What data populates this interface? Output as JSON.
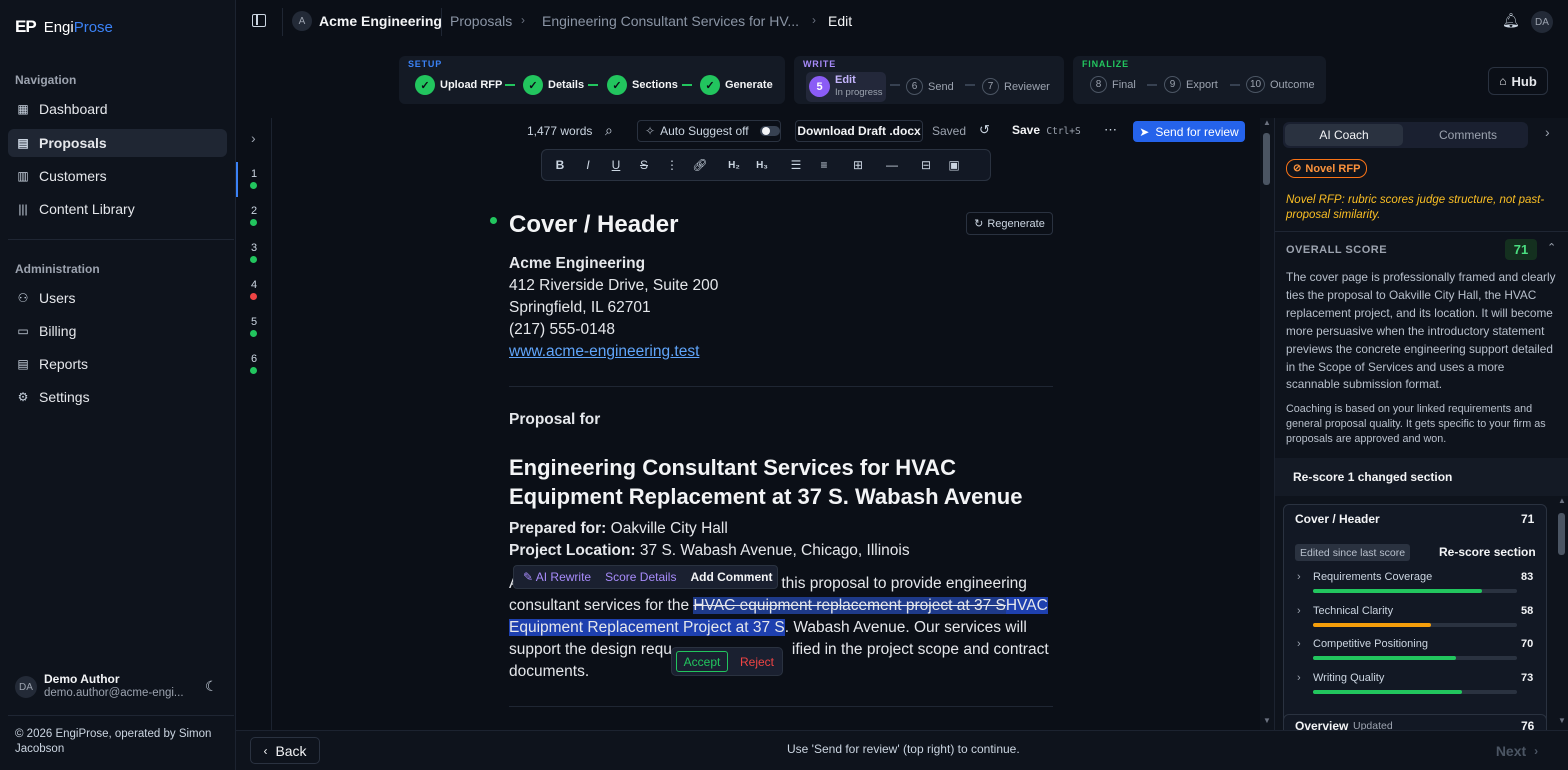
{
  "brand": {
    "mark": "EP",
    "name_a": "Engi",
    "name_b": "Prose"
  },
  "sidebar": {
    "nav_heading": "Navigation",
    "nav": [
      {
        "label": "Dashboard",
        "icon": "dashboard-icon"
      },
      {
        "label": "Proposals",
        "icon": "document-icon"
      },
      {
        "label": "Customers",
        "icon": "building-icon"
      },
      {
        "label": "Content Library",
        "icon": "library-icon"
      }
    ],
    "admin_heading": "Administration",
    "admin": [
      {
        "label": "Users",
        "icon": "users-icon"
      },
      {
        "label": "Billing",
        "icon": "card-icon"
      },
      {
        "label": "Reports",
        "icon": "reports-icon"
      },
      {
        "label": "Settings",
        "icon": "gear-icon"
      }
    ],
    "user": {
      "initials": "DA",
      "name": "Demo Author",
      "email": "demo.author@acme-engi..."
    },
    "footer": "© 2026 EngiProse, operated by Simon Jacobson"
  },
  "topbar": {
    "org_initial": "A",
    "org": "Acme Engineering",
    "crumb1": "Proposals",
    "crumb2": "Engineering Consultant Services for HV...",
    "crumb3": "Edit",
    "user_initials": "DA"
  },
  "workflow": {
    "setup": {
      "label": "SETUP",
      "steps": [
        "Upload RFP",
        "Details",
        "Sections",
        "Generate"
      ]
    },
    "write": {
      "label": "WRITE",
      "current": {
        "num": "5",
        "label": "Edit",
        "status": "In progress"
      },
      "steps": [
        {
          "num": "6",
          "label": "Send"
        },
        {
          "num": "7",
          "label": "Reviewer"
        }
      ]
    },
    "finalize": {
      "label": "FINALIZE",
      "steps": [
        {
          "num": "8",
          "label": "Final"
        },
        {
          "num": "9",
          "label": "Export"
        },
        {
          "num": "10",
          "label": "Outcome"
        }
      ]
    },
    "hub": "Hub"
  },
  "editor_bar": {
    "words": "1,477 words",
    "auto_suggest": "Auto Suggest off",
    "download": "Download Draft .docx",
    "saved": "Saved",
    "save": "Save",
    "save_kbd": "Ctrl+S",
    "send": "Send for review"
  },
  "format_toolbar": {
    "h2": "H₂",
    "h3": "H₃"
  },
  "sections": [
    {
      "n": "1",
      "status": "#22c55e"
    },
    {
      "n": "2",
      "status": "#22c55e"
    },
    {
      "n": "3",
      "status": "#22c55e"
    },
    {
      "n": "4",
      "status": "#ef4444"
    },
    {
      "n": "5",
      "status": "#22c55e"
    },
    {
      "n": "6",
      "status": "#22c55e"
    }
  ],
  "doc": {
    "heading": "Cover / Header",
    "regenerate": "Regenerate",
    "company": "Acme Engineering",
    "addr1": "412 Riverside Drive, Suite 200",
    "addr2": "Springfield, IL 62701",
    "phone": "(217) 555-0148",
    "web": "www.acme-engineering.test",
    "proposal_for": "Proposal for",
    "title1": "Engineering Consultant Services for HVAC",
    "title2": "Equipment Replacement at 37 S. Wabash Avenue",
    "prepared_label": "Prepared for:",
    "prepared": "Oakville City Hall",
    "location_label": "Project Location:",
    "location": "37 S. Wabash Avenue, Chicago, Illinois",
    "para_a": "A",
    "para_b": "this proposal to provide engineering",
    "para_c": "consultant services for the",
    "para_del": "HVAC equipment replacement project at 37 S",
    "para_ins_a": "HVAC",
    "para_ins_b": "Equipment Replacement Project at 37 S",
    "para_d": ". Wabash Avenue. Our services will",
    "para_e": "support the design requ",
    "para_f": "ified in the project scope and contract",
    "para_g": "documents."
  },
  "popup": {
    "ai_rewrite": "AI Rewrite",
    "score": "Score Details",
    "comment": "Add Comment",
    "accept": "Accept",
    "reject": "Reject"
  },
  "coach": {
    "tab1": "AI Coach",
    "tab2": "Comments",
    "badge": "Novel RFP",
    "note": "Novel RFP: rubric scores judge structure, not past-proposal similarity.",
    "overall_label": "OVERALL SCORE",
    "overall": "71",
    "summary": "The cover page is professionally framed and clearly ties the proposal to Oakville City Hall, the HVAC replacement project, and its location. It will become more persuasive when the introductory statement previews the concrete engineering support detailed in the Scope of Services and uses a more scannable submission format.",
    "basis": "Coaching is based on your linked requirements and general proposal quality. It gets specific to your firm as proposals are approved and won.",
    "rescore_all": "Re-score 1 changed section",
    "card_title": "Cover / Header",
    "card_score": "71",
    "edited": "Edited since last score",
    "rescore_sec": "Re-score section",
    "metrics": [
      {
        "label": "Requirements Coverage",
        "value": "83",
        "fill": 0.83,
        "color": "#22c55e"
      },
      {
        "label": "Technical Clarity",
        "value": "58",
        "fill": 0.58,
        "color": "#f59e0b"
      },
      {
        "label": "Competitive Positioning",
        "value": "70",
        "fill": 0.7,
        "color": "#22c55e"
      },
      {
        "label": "Writing Quality",
        "value": "73",
        "fill": 0.73,
        "color": "#22c55e"
      }
    ],
    "overview": "Overview",
    "overview_tag": "Updated",
    "overview_score": "76"
  },
  "bottom": {
    "back": "Back",
    "hint": "Use 'Send for review' (top right) to continue.",
    "next": "Next"
  }
}
